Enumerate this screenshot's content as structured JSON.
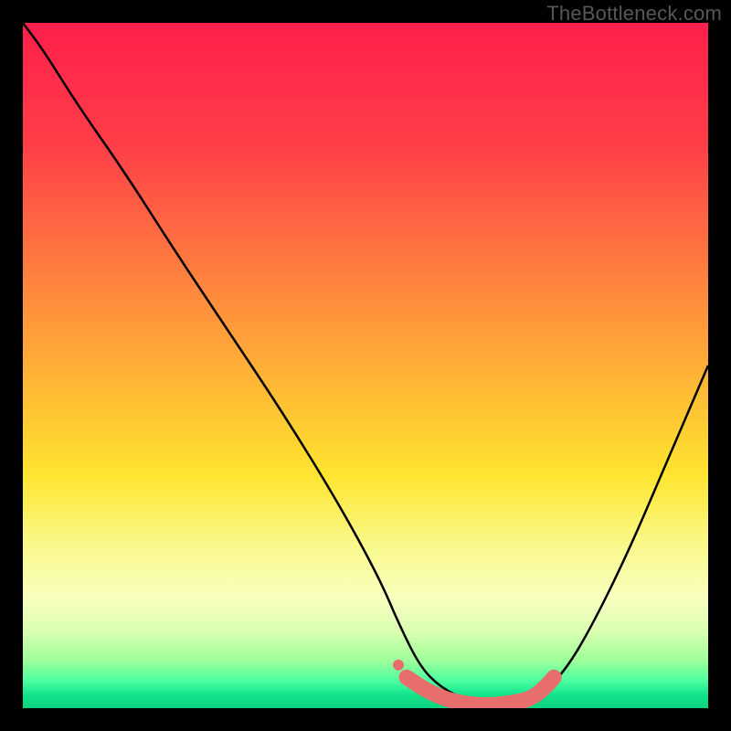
{
  "watermark": "TheBottleneck.com",
  "colors": {
    "frame": "#000000",
    "curve": "#000000",
    "marker": "#e86d6d",
    "marker_stroke": "#e86d6d"
  },
  "chart_data": {
    "type": "line",
    "title": "",
    "xlabel": "",
    "ylabel": "",
    "xlim": [
      0,
      100
    ],
    "ylim": [
      0,
      100
    ],
    "grid": false,
    "legend": false,
    "gradient_stops": [
      {
        "offset": 0,
        "color": "#ff1f4b"
      },
      {
        "offset": 18,
        "color": "#ff3f48"
      },
      {
        "offset": 35,
        "color": "#ff7a3f"
      },
      {
        "offset": 52,
        "color": "#ffb536"
      },
      {
        "offset": 66,
        "color": "#ffe52f"
      },
      {
        "offset": 76,
        "color": "#f9f98a"
      },
      {
        "offset": 84,
        "color": "#f9ffbf"
      },
      {
        "offset": 89,
        "color": "#d8ffb0"
      },
      {
        "offset": 93,
        "color": "#9fff9b"
      },
      {
        "offset": 96,
        "color": "#4dffa0"
      },
      {
        "offset": 98,
        "color": "#14e48c"
      },
      {
        "offset": 100,
        "color": "#0ad47f"
      }
    ],
    "series": [
      {
        "name": "bottleneck-curve",
        "x": [
          0,
          3,
          8,
          15,
          22,
          30,
          38,
          46,
          52,
          55,
          58,
          61,
          65,
          70,
          74,
          78,
          82,
          88,
          94,
          100
        ],
        "values": [
          100,
          96,
          88,
          78,
          67,
          55,
          43,
          30,
          19,
          12,
          6,
          3,
          1,
          0,
          1,
          4,
          10,
          22,
          36,
          50
        ]
      }
    ],
    "markers": {
      "name": "optimal-range",
      "x": [
        56,
        59,
        62,
        65,
        68,
        71,
        74,
        76,
        77.5
      ],
      "values": [
        4.5,
        2.5,
        1.2,
        0.6,
        0.4,
        0.7,
        1.3,
        2.8,
        4.5
      ]
    }
  }
}
